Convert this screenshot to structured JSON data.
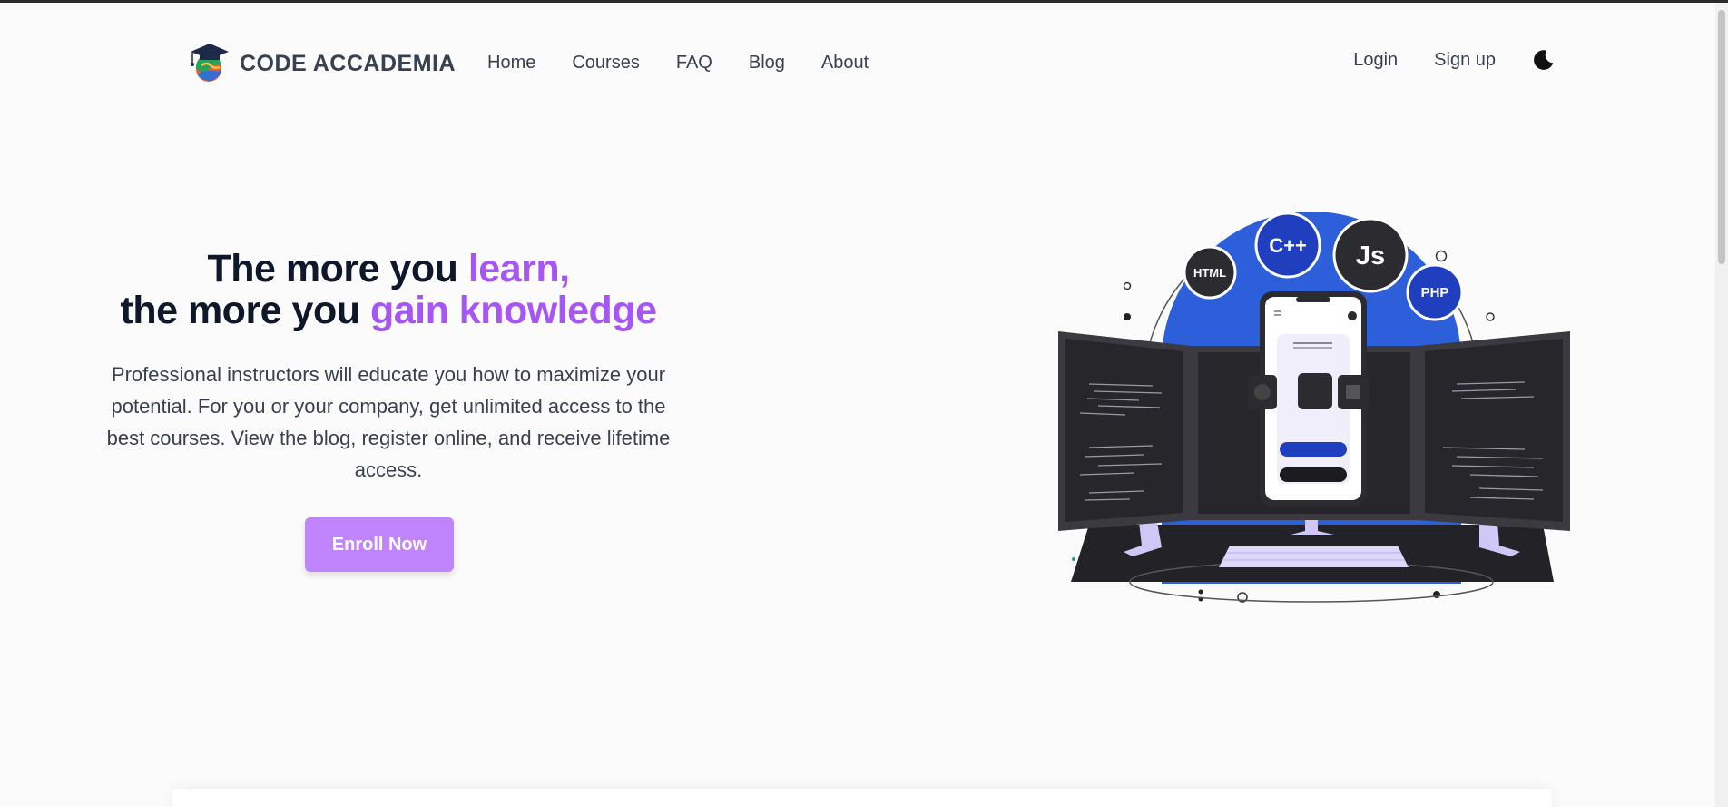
{
  "brand": {
    "name": "CODE ACCADEMIA",
    "logo_icon": "graduation-cap-globe-icon"
  },
  "nav": {
    "links": [
      {
        "label": "Home"
      },
      {
        "label": "Courses"
      },
      {
        "label": "FAQ"
      },
      {
        "label": "Blog"
      },
      {
        "label": "About"
      }
    ],
    "login_label": "Login",
    "signup_label": "Sign up",
    "theme_icon": "moon-icon"
  },
  "hero": {
    "title_part1": "The more you ",
    "title_accent1": "learn,",
    "title_part2": "the more you ",
    "title_accent2": "gain knowledge",
    "description": "Professional instructors will educate you how to maximize your potential. For you or your company, get unlimited access to the best courses. View the blog, register online, and receive lifetime access.",
    "cta_label": "Enroll Now"
  },
  "illustration": {
    "badges": [
      "HTML",
      "C++",
      "Js",
      "PHP"
    ]
  },
  "colors": {
    "accent": "#a855f7",
    "button": "#c084fc",
    "illustration_blue": "#2c5fd9",
    "dark": "#2b2b30"
  }
}
